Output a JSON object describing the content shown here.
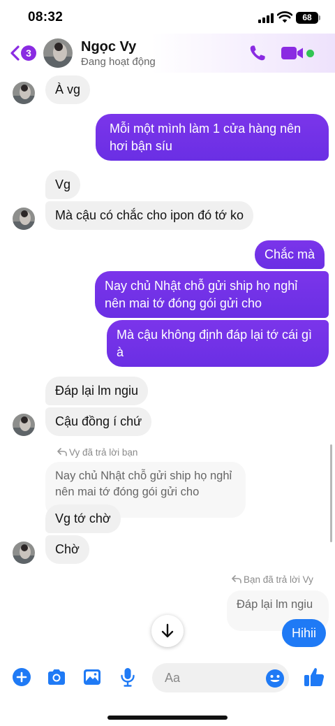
{
  "status_bar": {
    "time": "08:32",
    "battery": "68"
  },
  "header": {
    "unread_count": "3",
    "contact_name": "Ngọc Vy",
    "presence": "Đang hoạt động"
  },
  "messages": [
    {
      "side": "in",
      "text": "À vg"
    },
    {
      "side": "out",
      "text": "Mỗi một mình làm 1 cửa hàng nên hơi bận síu"
    },
    {
      "side": "in",
      "text": "Vg"
    },
    {
      "side": "in",
      "text": "Mà cậu có chắc cho ipon đó tớ ko"
    },
    {
      "side": "out",
      "text": "Chắc mà"
    },
    {
      "side": "out",
      "text": "Nay chủ Nhật chỗ gửi ship họ nghỉ nên mai tớ đóng gói gửi cho"
    },
    {
      "side": "out",
      "text": "Mà cậu không định đáp lại tớ cái gì à"
    },
    {
      "side": "in",
      "text": "Đáp lại lm ngiu"
    },
    {
      "side": "in",
      "text": "Cậu đồng í chứ"
    },
    {
      "side": "in",
      "text": "Vg tớ chờ"
    },
    {
      "side": "in",
      "text": "Chờ"
    },
    {
      "side": "out",
      "text": "Hihii"
    }
  ],
  "replies": [
    {
      "label": "Vy đã trả lời bạn",
      "quoted": "Nay chủ Nhật chỗ gửi ship họ nghỉ nên mai tớ đóng gói gửi cho"
    },
    {
      "label": "Bạn đã trả lời Vy",
      "quoted": "Đáp lại lm ngiu"
    }
  ],
  "composer": {
    "placeholder": "Aa"
  },
  "colors": {
    "accent": "#7b35ea",
    "brand_blue": "#1f7af5",
    "online": "#31c553"
  },
  "icons": [
    "back-chevron-icon",
    "phone-icon",
    "video-camera-icon",
    "plus-icon",
    "camera-icon",
    "image-icon",
    "microphone-icon",
    "emoji-icon",
    "thumbs-up-icon",
    "arrow-down-icon"
  ]
}
